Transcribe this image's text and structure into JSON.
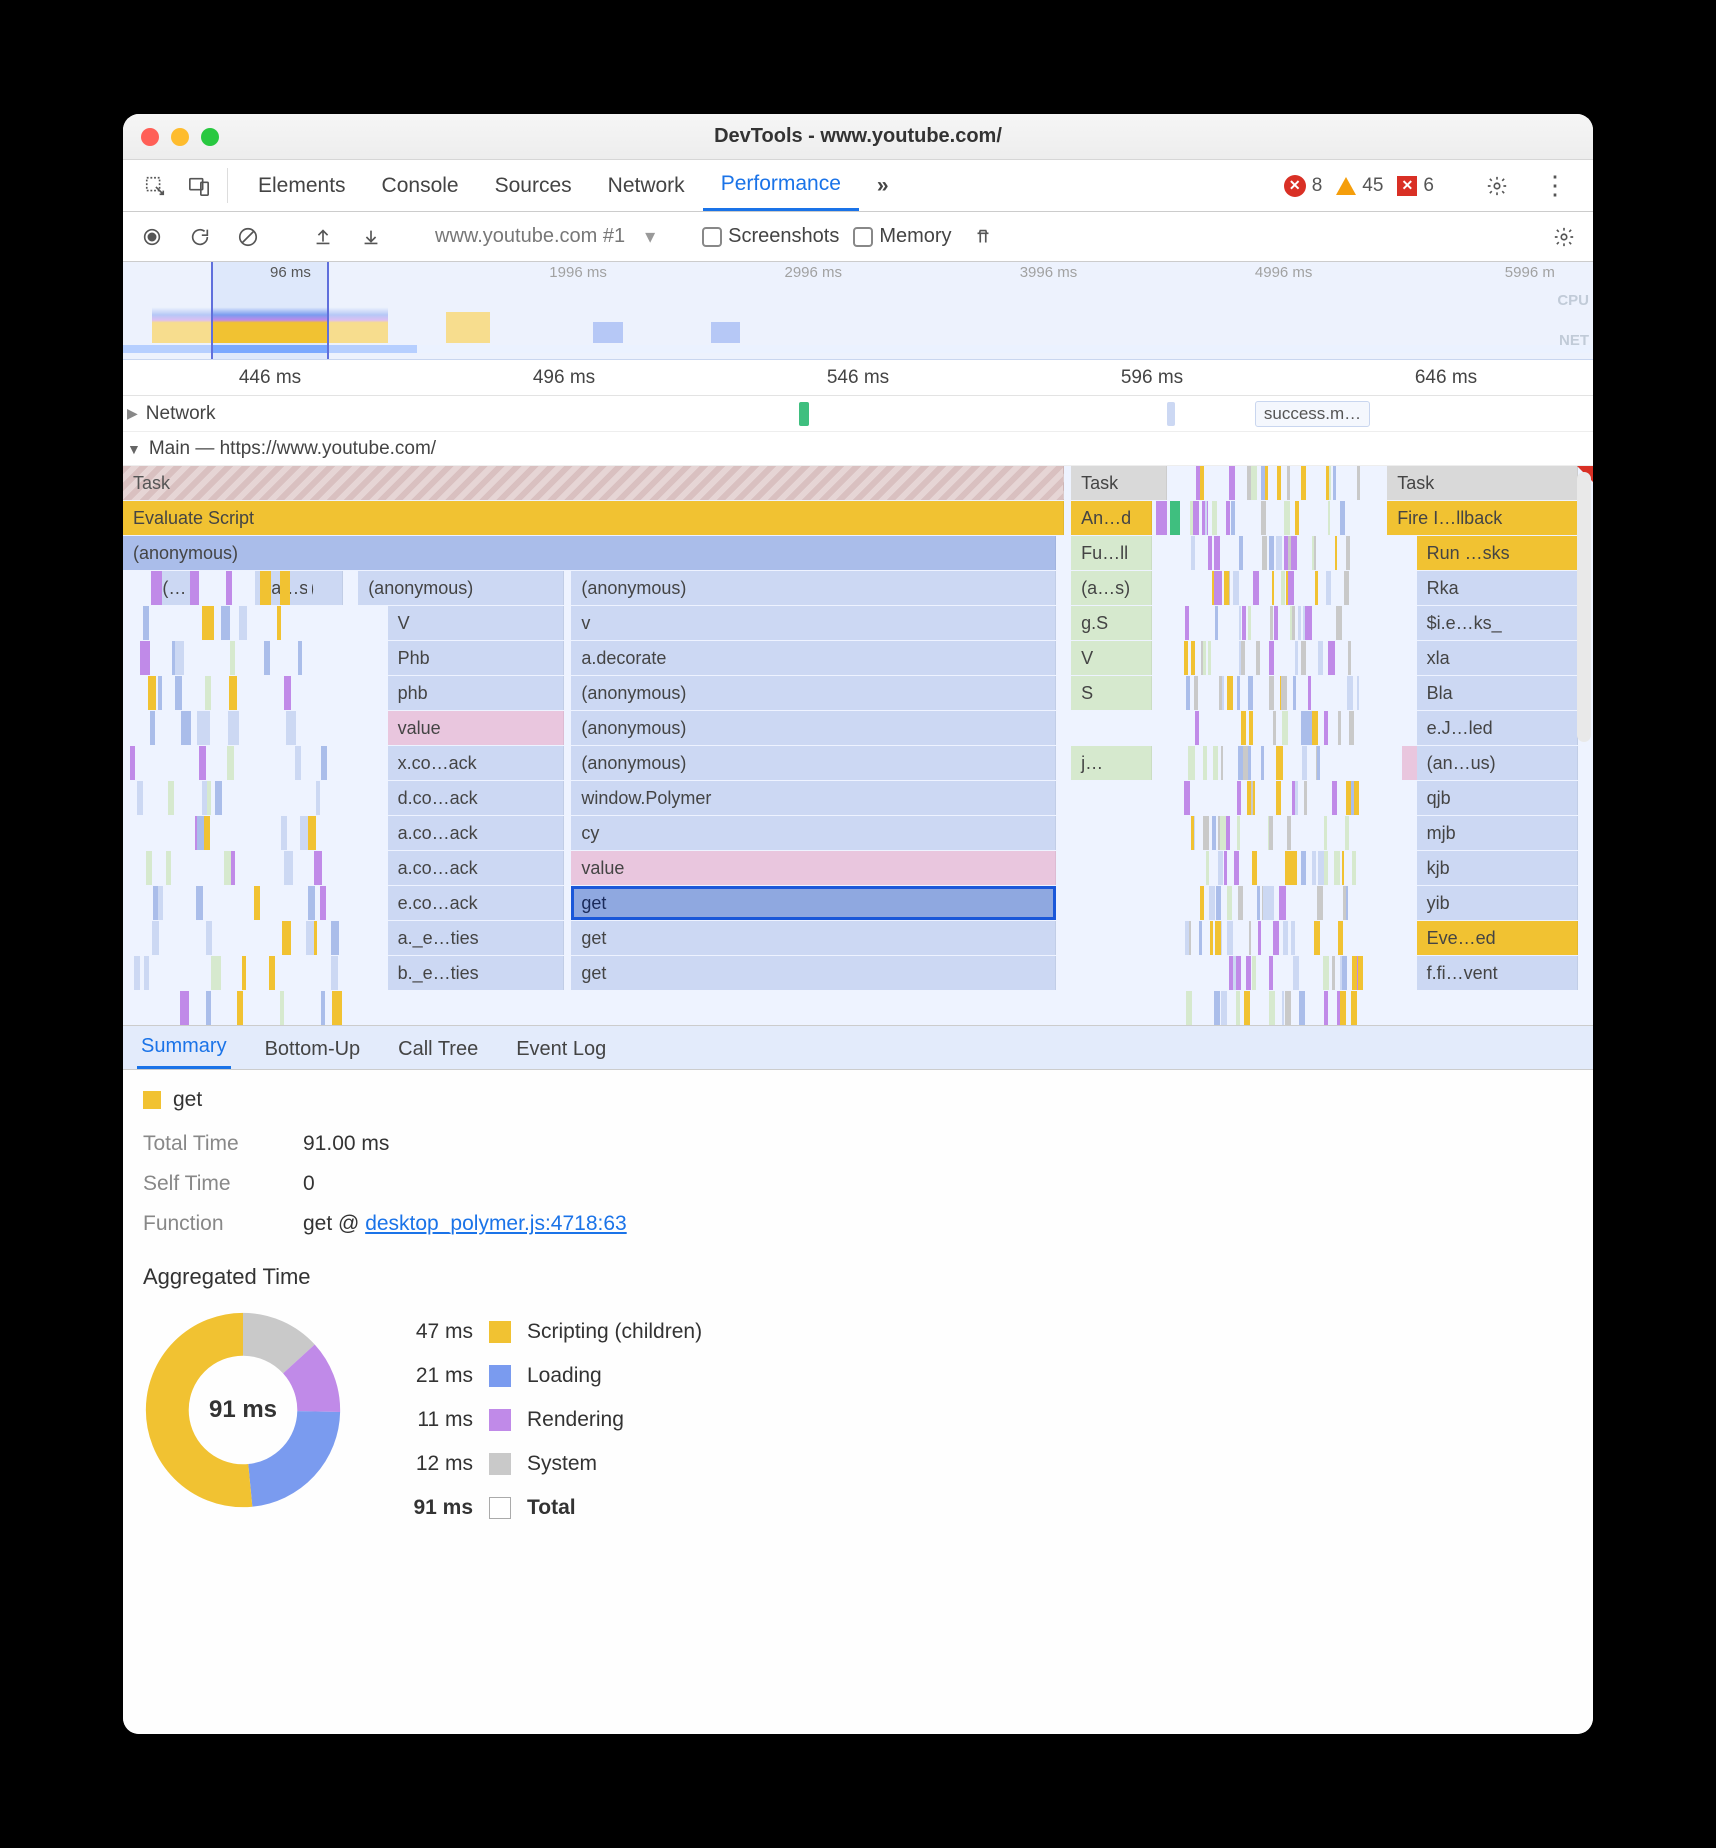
{
  "window": {
    "title": "DevTools - www.youtube.com/"
  },
  "topTabs": [
    "Elements",
    "Console",
    "Sources",
    "Network",
    "Performance"
  ],
  "topTabsActive": "Performance",
  "overflowIcon": "»",
  "badges": {
    "errors": "8",
    "warnings": "45",
    "violations": "6"
  },
  "perfToolbar": {
    "target": "www.youtube.com #1",
    "screenshotsLabel": "Screenshots",
    "memoryLabel": "Memory"
  },
  "overview": {
    "ticks": [
      {
        "label": "96 ms",
        "pos": 10
      },
      {
        "label": "1996 ms",
        "pos": 29
      },
      {
        "label": "2996 ms",
        "pos": 45
      },
      {
        "label": "3996 ms",
        "pos": 61
      },
      {
        "label": "4996 ms",
        "pos": 77
      },
      {
        "label": "5996 m",
        "pos": 94
      }
    ],
    "cpuLabel": "CPU",
    "netLabel": "NET"
  },
  "ruler": [
    {
      "label": "446 ms",
      "pos": 10
    },
    {
      "label": "496 ms",
      "pos": 30
    },
    {
      "label": "546 ms",
      "pos": 50
    },
    {
      "label": "596 ms",
      "pos": 70
    },
    {
      "label": "646 ms",
      "pos": 90
    }
  ],
  "lanes": {
    "network": "Network",
    "networkChip": "success.m…",
    "main": "Main — https://www.youtube.com/"
  },
  "flame": {
    "col1": {
      "task": "Task",
      "evalScript": "Evaluate Script",
      "anon": "(anonymous)",
      "row3": [
        "(…",
        "(a…s)",
        "(anonymous)",
        "(anonymous)"
      ],
      "stackA": [
        "V",
        "Phb",
        "phb",
        "value",
        "x.co…ack",
        "d.co…ack",
        "a.co…ack",
        "a.co…ack",
        "e.co…ack",
        "a._e…ties",
        "b._e…ties"
      ],
      "stackB": [
        "v",
        "a.decorate",
        "(anonymous)",
        "(anonymous)",
        "(anonymous)",
        "window.Polymer",
        "cy",
        "value",
        "get",
        "get",
        "get"
      ]
    },
    "col2": {
      "task": "Task",
      "row1": "An…d",
      "row2": "Fu…ll",
      "row3": "(a…s)",
      "stack": [
        "g.S",
        "V",
        "S",
        "",
        "j…"
      ]
    },
    "col3": {
      "task": "Task",
      "row1": "Fire I…llback",
      "row2": "Run …sks",
      "stack": [
        "Rka",
        "$i.e…ks_",
        "xla",
        "Bla",
        "e.J…led",
        "(an…us)",
        "qjb",
        "mjb",
        "kjb",
        "yib",
        "Eve…ed",
        "f.fi…vent"
      ]
    },
    "selected": "get"
  },
  "detailTabs": [
    "Summary",
    "Bottom-Up",
    "Call Tree",
    "Event Log"
  ],
  "detailTabsActive": "Summary",
  "summary": {
    "name": "get",
    "totalTimeLabel": "Total Time",
    "totalTimeValue": "91.00 ms",
    "selfTimeLabel": "Self Time",
    "selfTimeValue": "0",
    "functionLabel": "Function",
    "functionPrefix": "get @ ",
    "functionLink": "desktop_polymer.js:4718:63",
    "aggHeader": "Aggregated Time",
    "donutCenter": "91 ms",
    "legend": [
      {
        "ms": "47 ms",
        "color": "#f1c232",
        "name": "Scripting (children)"
      },
      {
        "ms": "21 ms",
        "color": "#7a9bef",
        "name": "Loading"
      },
      {
        "ms": "11 ms",
        "color": "#c08ae8",
        "name": "Rendering"
      },
      {
        "ms": "12 ms",
        "color": "#c9c9c9",
        "name": "System"
      }
    ],
    "totalRow": {
      "ms": "91 ms",
      "name": "Total"
    }
  },
  "chart_data": {
    "type": "pie",
    "title": "Aggregated Time",
    "unit": "ms",
    "total": 91,
    "series": [
      {
        "name": "Scripting (children)",
        "value": 47,
        "color": "#f1c232"
      },
      {
        "name": "Loading",
        "value": 21,
        "color": "#7a9bef"
      },
      {
        "name": "Rendering",
        "value": 11,
        "color": "#c08ae8"
      },
      {
        "name": "System",
        "value": 12,
        "color": "#c9c9c9"
      }
    ]
  }
}
